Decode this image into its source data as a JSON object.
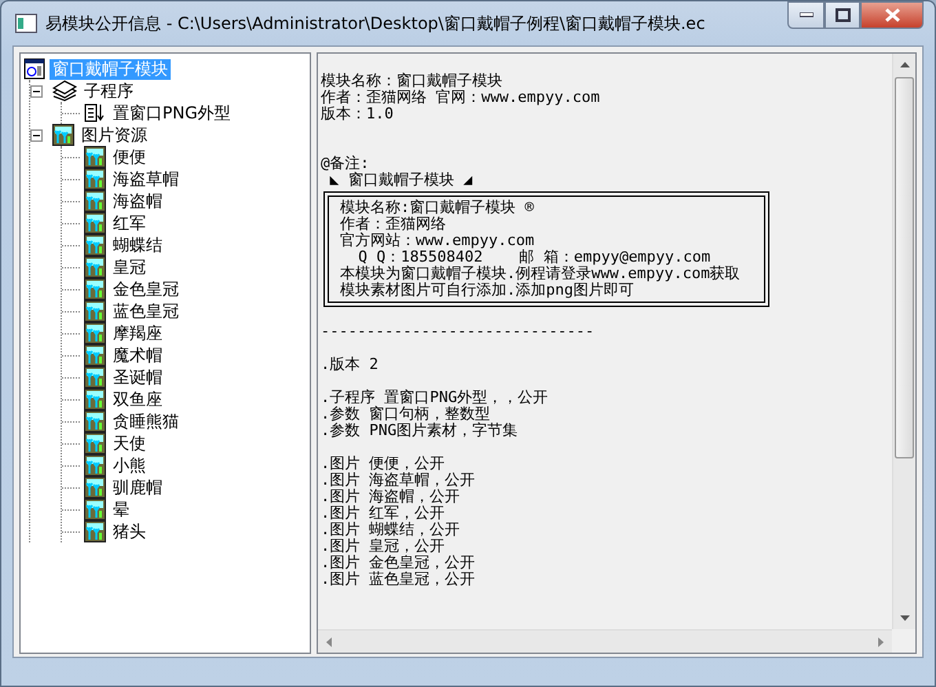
{
  "window": {
    "title": "易模块公开信息 - C:\\Users\\Administrator\\Desktop\\窗口戴帽子例程\\窗口戴帽子模块.ec"
  },
  "tree": {
    "items": [
      {
        "kind": "module",
        "label": "窗口戴帽子模块",
        "selected": true,
        "children": [
          {
            "kind": "subroutines",
            "label": "子程序",
            "selected": false,
            "expanded": true,
            "children": [
              {
                "kind": "subroutine",
                "label": "置窗口PNG外型",
                "selected": false
              }
            ]
          },
          {
            "kind": "images",
            "label": "图片资源",
            "selected": false,
            "expanded": true,
            "children": [
              {
                "kind": "image",
                "label": "便便",
                "selected": false
              },
              {
                "kind": "image",
                "label": "海盗草帽",
                "selected": false
              },
              {
                "kind": "image",
                "label": "海盗帽",
                "selected": false
              },
              {
                "kind": "image",
                "label": "红军",
                "selected": false
              },
              {
                "kind": "image",
                "label": "蝴蝶结",
                "selected": false
              },
              {
                "kind": "image",
                "label": "皇冠",
                "selected": false
              },
              {
                "kind": "image",
                "label": "金色皇冠",
                "selected": false
              },
              {
                "kind": "image",
                "label": "蓝色皇冠",
                "selected": false
              },
              {
                "kind": "image",
                "label": "摩羯座",
                "selected": false
              },
              {
                "kind": "image",
                "label": "魔术帽",
                "selected": false
              },
              {
                "kind": "image",
                "label": "圣诞帽",
                "selected": false
              },
              {
                "kind": "image",
                "label": "双鱼座",
                "selected": false
              },
              {
                "kind": "image",
                "label": "贪睡熊猫",
                "selected": false
              },
              {
                "kind": "image",
                "label": "天使",
                "selected": false
              },
              {
                "kind": "image",
                "label": "小熊",
                "selected": false
              },
              {
                "kind": "image",
                "label": "驯鹿帽",
                "selected": false
              },
              {
                "kind": "image",
                "label": "晕",
                "selected": false
              },
              {
                "kind": "image",
                "label": "猪头",
                "selected": false
              }
            ]
          }
        ]
      }
    ]
  },
  "text_pane": {
    "lines": [
      {
        "kind": "blank"
      },
      {
        "kind": "text",
        "text": "模块名称：窗口戴帽子模块"
      },
      {
        "kind": "text",
        "text": "作者：歪猫网络 官网：www.empyy.com"
      },
      {
        "kind": "text",
        "text": "版本：1.0"
      },
      {
        "kind": "blank"
      },
      {
        "kind": "blank"
      },
      {
        "kind": "text",
        "text": "@备注:"
      },
      {
        "kind": "text",
        "text": " ◣ 窗口戴帽子模块 ◢"
      },
      {
        "kind": "box",
        "lines": [
          "模块名称:窗口戴帽子模块 ®",
          "作者：歪猫网络",
          "官方网站：www.empyy.com",
          "  Q Q：185508402    邮 箱：empyy@empyy.com",
          "本模块为窗口戴帽子模块.例程请登录www.empyy.com获取",
          "模块素材图片可自行添加.添加png图片即可"
        ]
      },
      {
        "kind": "blank"
      },
      {
        "kind": "text",
        "text": "------------------------------"
      },
      {
        "kind": "blank"
      },
      {
        "kind": "text",
        "text": ".版本 2"
      },
      {
        "kind": "blank"
      },
      {
        "kind": "text",
        "text": ".子程序 置窗口PNG外型，，公开"
      },
      {
        "kind": "text",
        "text": ".参数 窗口句柄，整数型"
      },
      {
        "kind": "text",
        "text": ".参数 PNG图片素材，字节集"
      },
      {
        "kind": "blank"
      },
      {
        "kind": "text",
        "text": ".图片 便便，公开"
      },
      {
        "kind": "text",
        "text": ".图片 海盗草帽，公开"
      },
      {
        "kind": "text",
        "text": ".图片 海盗帽，公开"
      },
      {
        "kind": "text",
        "text": ".图片 红军，公开"
      },
      {
        "kind": "text",
        "text": ".图片 蝴蝶结，公开"
      },
      {
        "kind": "text",
        "text": ".图片 皇冠，公开"
      },
      {
        "kind": "text",
        "text": ".图片 金色皇冠，公开"
      },
      {
        "kind": "text",
        "text": ".图片 蓝色皇冠，公开"
      }
    ]
  }
}
